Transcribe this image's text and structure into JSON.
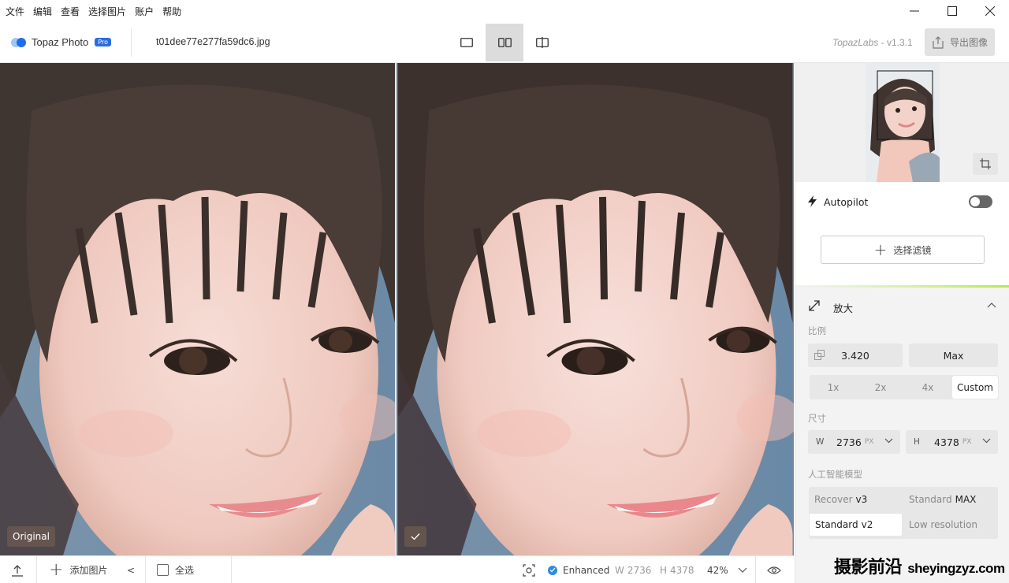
{
  "menu": [
    "文件",
    "编辑",
    "查看",
    "选择图片",
    "账户",
    "帮助"
  ],
  "toolbar": {
    "app_name": "Topaz Photo",
    "badge": "Pro",
    "filename": "t01dee77e277fa59dc6.jpg",
    "brand": "TopazLabs",
    "version": "- v1.3.1",
    "export_label": "导出图像"
  },
  "viewer": {
    "original_label": "Original"
  },
  "bottombar": {
    "add_images": "添加图片",
    "collapse": "<",
    "select_all": "全选",
    "enhanced": "Enhanced",
    "width_label": "W",
    "width_value": "2736",
    "height_label": "H",
    "height_value": "4378",
    "zoom": "42%"
  },
  "panel": {
    "autopilot": "Autopilot",
    "autopilot_on": false,
    "select_filter": "选择滤镜",
    "upscale": {
      "title": "放大",
      "scale_label": "比例",
      "scale_value": "3.420",
      "max_label": "Max",
      "presets": [
        "1x",
        "2x",
        "4x",
        "Custom"
      ],
      "active_preset": "Custom",
      "size_label": "尺寸",
      "w_axis": "W",
      "w_value": "2736",
      "h_axis": "H",
      "h_value": "4378",
      "unit": "PX",
      "model_label": "人工智能模型",
      "models": [
        {
          "name": "Recover",
          "variant": "v3"
        },
        {
          "name": "Standard",
          "variant": "MAX"
        },
        {
          "name": "Standard",
          "variant": "v2"
        },
        {
          "name": "Low resolution",
          "variant": ""
        }
      ],
      "active_model": "Standard v2"
    }
  },
  "watermark": {
    "cn": "摄影前沿",
    "url": "sheyingzyz.com"
  },
  "colors": {
    "accent_blue": "#2b6de0",
    "enhanced_blue": "#2b8ae8",
    "accent_green": "#b6e84f"
  }
}
